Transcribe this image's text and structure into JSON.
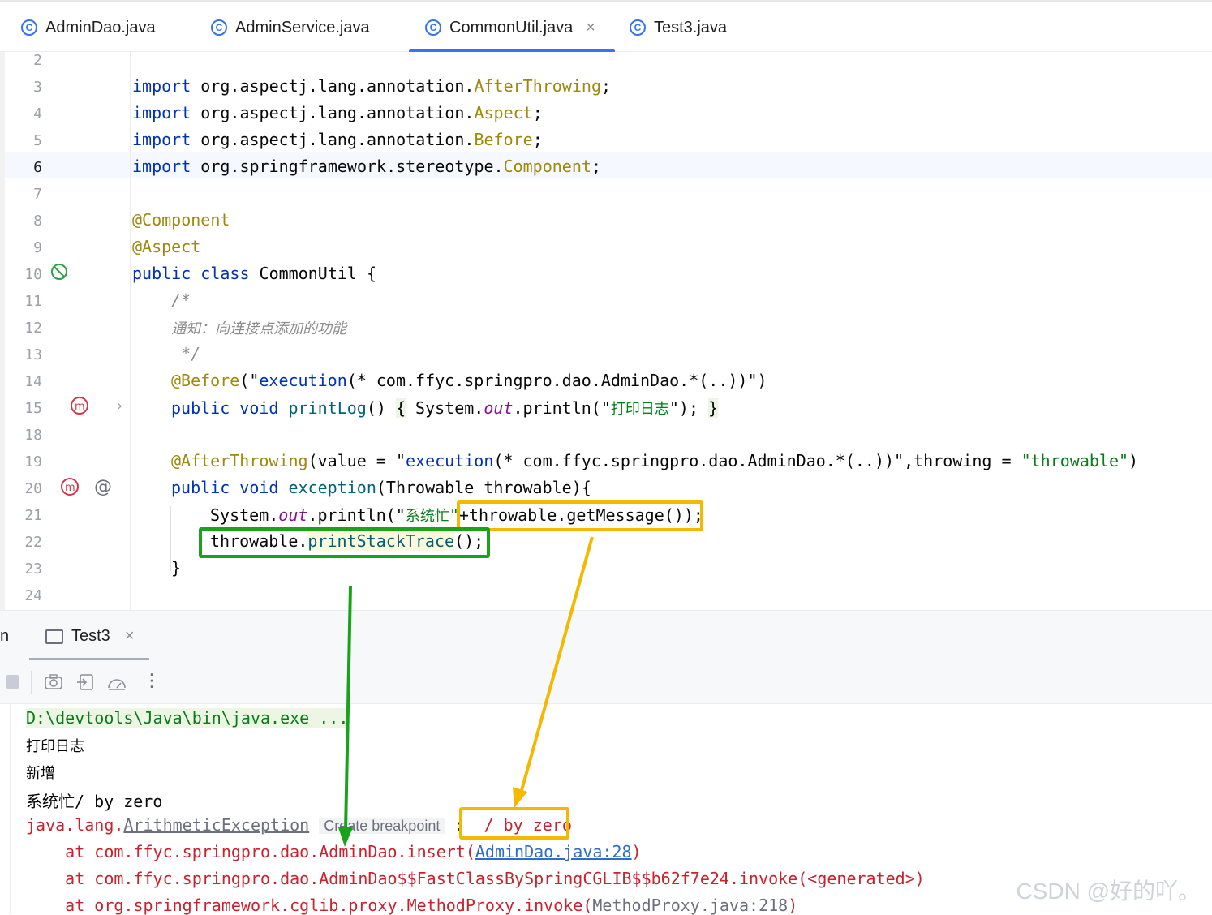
{
  "tabs": [
    {
      "label": "AdminDao.java",
      "icon": "class-icon"
    },
    {
      "label": "AdminService.java",
      "icon": "class-icon"
    },
    {
      "label": "CommonUtil.java",
      "icon": "class-icon",
      "active": true,
      "close": "×"
    },
    {
      "label": "Test3.java",
      "icon": "class-icon"
    }
  ],
  "editor": {
    "line_numbers": [
      "2",
      "3",
      "4",
      "5",
      "6",
      "7",
      "8",
      "9",
      "10",
      "11",
      "12",
      "13",
      "14",
      "15",
      "18",
      "19",
      "20",
      "21",
      "22",
      "23",
      "24"
    ],
    "current_line": "6",
    "lines": {
      "l3": {
        "kw": "import",
        "pkg": " org.aspectj.lang.annotation.",
        "cls": "AfterThrowing",
        "end": ";"
      },
      "l4": {
        "kw": "import",
        "pkg": " org.aspectj.lang.annotation.",
        "cls": "Aspect",
        "end": ";"
      },
      "l5": {
        "kw": "import",
        "pkg": " org.aspectj.lang.annotation.",
        "cls": "Before",
        "end": ";"
      },
      "l6": {
        "kw": "import",
        "pkg": " org.springframework.stereotype.",
        "cls": "Component",
        "end": ";"
      },
      "l8": {
        "ann": "@Component"
      },
      "l9": {
        "ann": "@Aspect"
      },
      "l10": {
        "kw1": "public",
        "kw2": "class",
        "rest": " CommonUtil {"
      },
      "l11": {
        "cmt": "/*"
      },
      "l12": {
        "cmt": "通知：向连接点添加的功能"
      },
      "l13": {
        "cmt": " */"
      },
      "l14": {
        "ann": "@Before",
        "p1": "(\"",
        "str": "execution",
        "p2": "(* com.ffyc.springpro.dao.AdminDao.*(..))\")"
      },
      "l15": {
        "kw1": "public",
        "kw2": "void",
        "fn": "printLog",
        "p1": "() ",
        "brace1": "{",
        "p2": " System.",
        "fld": "out",
        "p3": ".println(\"",
        "str": "打印日志",
        "p4": "\"); ",
        "brace2": "}"
      },
      "l19": {
        "ann": "@AfterThrowing",
        "p1": "(value = \"",
        "str": "execution",
        "p2": "(* com.ffyc.springpro.dao.AdminDao.*(..))\",throwing = ",
        "str2": "\"throwable\"",
        "p3": ")"
      },
      "l20": {
        "kw1": "public",
        "kw2": "void",
        "fn": "exception",
        "rest": "(Throwable throwable){"
      },
      "l21": {
        "p1": "System.",
        "fld": "out",
        "p2": ".println(\"",
        "str": "系统忙",
        "p3": "\"",
        "p4": "+throwable.getMessage());"
      },
      "l22": {
        "p1": "throwable.",
        "fn": "printStackTrace",
        "p2": "();"
      },
      "l23": {
        "rest": "}"
      }
    }
  },
  "run_panel": {
    "side_label": "n",
    "tab_label": "Test3",
    "tab_close": "×",
    "toolbar_icons": [
      "stop-icon",
      "camera-icon",
      "login-icon",
      "dashboard-icon",
      "more-icon"
    ],
    "more_glyph": "⋮",
    "output": {
      "cmd": "D:\\devtools\\Java\\bin\\java.exe ...",
      "line1": "打印日志",
      "line2": "新增",
      "line3": "系统忙/ by zero",
      "exc_pkg": "java.lang.",
      "exc_cls": "ArithmeticException",
      "hint": "Create breakpoint",
      "exc_colon": " :",
      "exc_msg": " / by zero",
      "at1_pre": "    at com.ffyc.springpro.dao.AdminDao.insert(",
      "at1_link": "AdminDao.java:28",
      "at1_post": ")",
      "at2": "    at com.ffyc.springpro.dao.AdminDao$$FastClassBySpringCGLIB$$b62f7e24.invoke(<generated>)",
      "at3_pre": "    at org.springframework.cglib.proxy.MethodProxy.invoke(",
      "at3_link": "MethodProxy.java:218",
      "at3_post": ")"
    }
  },
  "watermark": "CSDN @好的吖。",
  "colors": {
    "keyword": "#0033b3",
    "annotation": "#9e880d",
    "string": "#067d17",
    "accent": "#3574f0",
    "orange_box": "#f5b800",
    "green_box": "#19a31a",
    "error": "#c7222d"
  }
}
